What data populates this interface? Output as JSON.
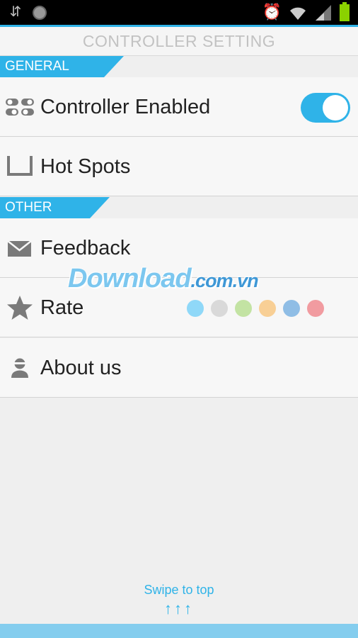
{
  "status_bar": {
    "icons": [
      "usb-icon",
      "record-icon",
      "alarm-icon",
      "wifi-icon",
      "signal-icon",
      "battery-icon"
    ]
  },
  "title": "CONTROLLER SETTING",
  "sections": {
    "general": "GENERAL",
    "other": "OTHER"
  },
  "items": {
    "controller_enabled": "Controller Enabled",
    "hot_spots": "Hot Spots",
    "feedback": "Feedback",
    "rate": "Rate",
    "about": "About us"
  },
  "controller_enabled_on": true,
  "rate_colors": [
    "#8fd8f8",
    "#d9d9d9",
    "#c3e3a3",
    "#f8cf95",
    "#8fbde5",
    "#f19ba0"
  ],
  "watermark": {
    "main": "Download",
    "suffix": ".com.vn"
  },
  "swipe": {
    "label": "Swipe to top",
    "arrows": "↑↑↑"
  },
  "colors": {
    "accent": "#2fb3e8",
    "bottom_bar": "#84cdee"
  }
}
